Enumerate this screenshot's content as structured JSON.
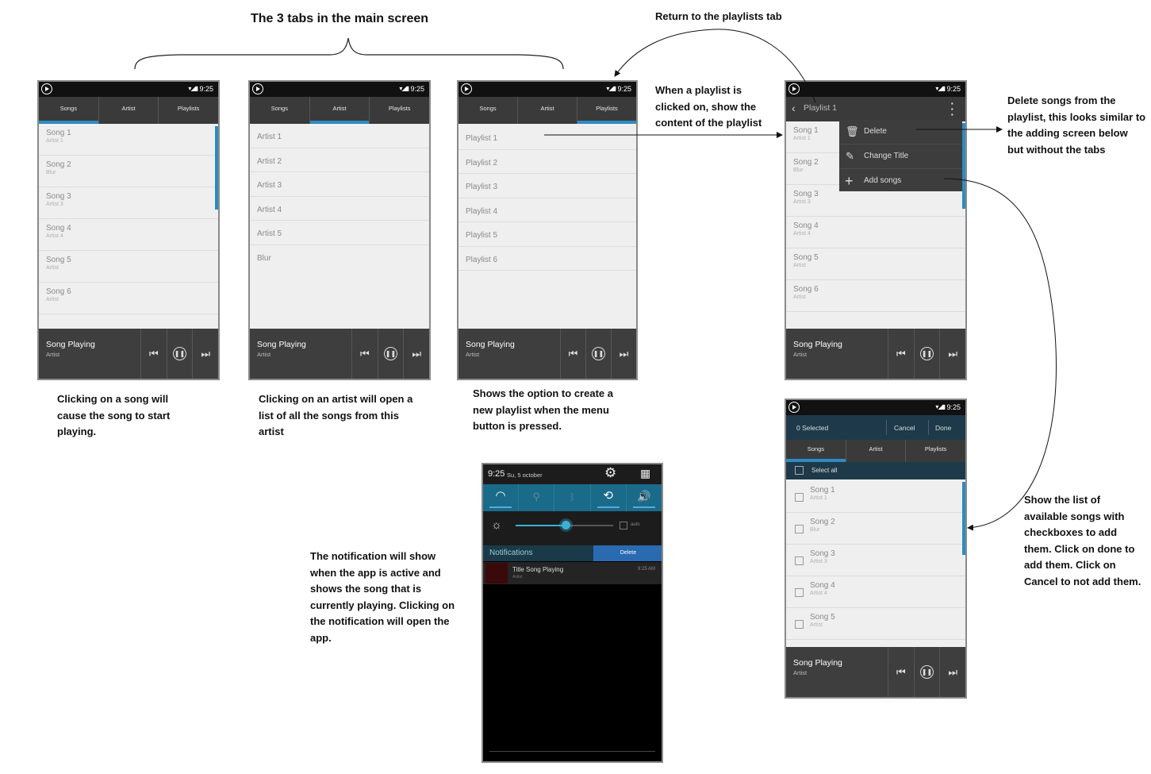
{
  "title": "The 3 tabs in the main screen",
  "status_time": "9:25",
  "tabs": [
    "Songs",
    "Artist",
    "Playlists"
  ],
  "player": {
    "title": "Song Playing",
    "subtitle": "Artist"
  },
  "songs": [
    {
      "title": "Song 1",
      "sub": "Artist 1"
    },
    {
      "title": "Song 2",
      "sub": "Blur"
    },
    {
      "title": "Song 3",
      "sub": "Artist 3"
    },
    {
      "title": "Song 4",
      "sub": "Artist 4"
    },
    {
      "title": "Song 5",
      "sub": "Artist"
    },
    {
      "title": "Song 6",
      "sub": "Artist"
    }
  ],
  "artists": [
    "Artist 1",
    "Artist 2",
    "Artist 3",
    "Artist 4",
    "Artist 5",
    "Blur"
  ],
  "playlists": [
    "Playlist 1",
    "Playlist 2",
    "Playlist 3",
    "Playlist 4",
    "Playlist 5",
    "Playlist 6"
  ],
  "playlist_screen": {
    "header": "Playlist 1",
    "menu": [
      "Delete",
      "Change Title",
      "Add songs"
    ]
  },
  "add_screen": {
    "selected": "0 Selected",
    "cancel": "Cancel",
    "done": "Done",
    "select_all": "Select all"
  },
  "notification_screen": {
    "time": "9:25",
    "date": "Su, 5 october",
    "auto": "auto",
    "notifications_label": "Notifications",
    "delete_label": "Delete",
    "notif_title": "Title Song Playing",
    "notif_sub": "Artist",
    "notif_time": "9:25 AM"
  },
  "captions": {
    "songs": [
      "Clicking on a  song will",
      "cause the song to  start",
      "playing."
    ],
    "artist": [
      "Clicking on an artist will open a",
      "list of all the songs from this",
      "artist"
    ],
    "playlists": [
      "Shows the option to create a",
      "new playlist when the menu",
      "button is pressed."
    ],
    "playlist_click": [
      "When a playlist is",
      "clicked on, show the",
      "content of the playlist"
    ],
    "return": "Return to the playlists tab",
    "delete": [
      "Delete songs from the",
      "playlist, this looks similar to",
      "the adding screen below",
      "but without the tabs"
    ],
    "add": [
      "Show the list of",
      "available songs with",
      "checkboxes to add",
      "them. Click on done to",
      "add them. Click on",
      "Cancel to not add them."
    ],
    "notification": [
      "The notification will show",
      "when the app is active and",
      "shows the song that is",
      "currently playing. Clicking on",
      "the notification will open the",
      "app."
    ]
  }
}
